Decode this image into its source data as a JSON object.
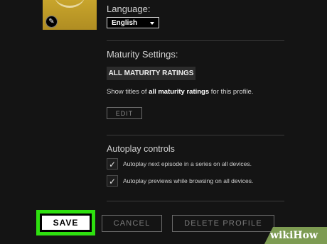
{
  "profile": {
    "language_label": "Language:",
    "language_value": "English",
    "maturity_label": "Maturity Settings:",
    "maturity_badge": "ALL MATURITY RATINGS",
    "maturity_desc_prefix": "Show titles of ",
    "maturity_desc_bold": "all maturity ratings",
    "maturity_desc_suffix": " for this profile.",
    "edit_label": "EDIT",
    "autoplay_label": "Autoplay controls",
    "autoplay_options": [
      {
        "label": "Autoplay next episode in a series on all devices.",
        "checked": true
      },
      {
        "label": "Autoplay previews while browsing on all devices.",
        "checked": true
      }
    ]
  },
  "actions": {
    "save_label": "SAVE",
    "cancel_label": "CANCEL",
    "delete_label": "DELETE PROFILE"
  },
  "watermark": "wikiHow",
  "colors": {
    "background": "#141414",
    "highlight": "#2ee00f",
    "avatar": "#c8a52c",
    "watermark_bg": "#7d9b52"
  },
  "icons": {
    "avatar_edit": "pencil-icon",
    "language_caret": "caret-down-icon",
    "checkbox_check": "checkmark-icon"
  }
}
